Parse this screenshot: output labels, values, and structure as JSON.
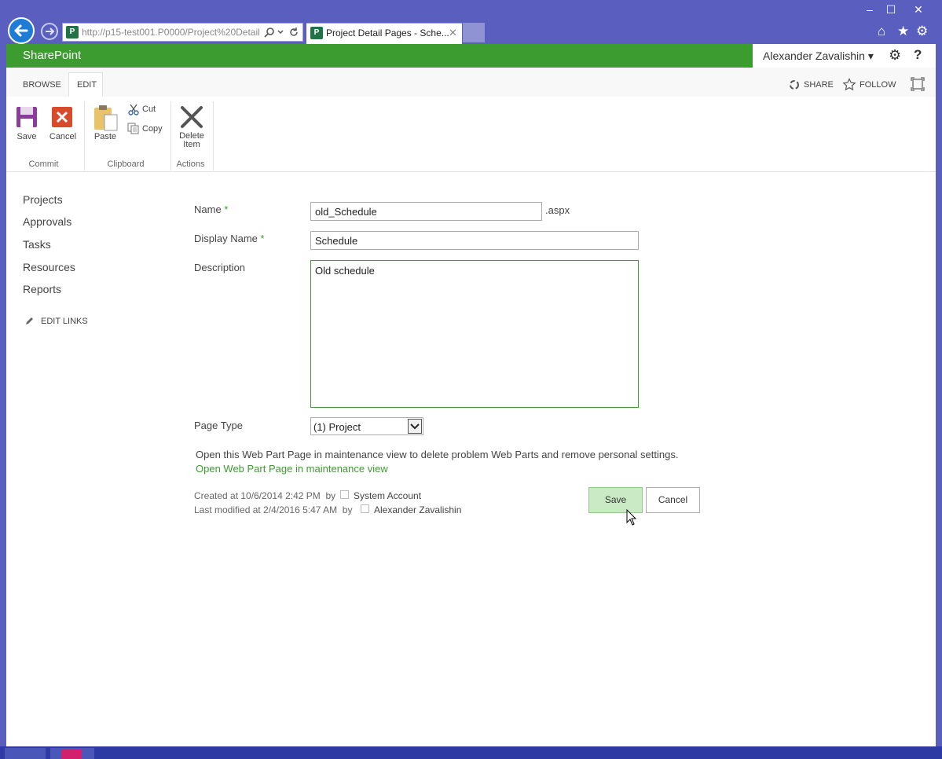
{
  "browser": {
    "url": "http://p15-test001.P0000/Project%20Detail",
    "tab_title": "Project Detail Pages - Sche...",
    "tab_close": "✕",
    "minimize": "–",
    "maximize": "☐",
    "close": "✕",
    "home_icon": "⌂",
    "favorites_icon": "★",
    "tools_icon": "⚙"
  },
  "suite": {
    "brand": "SharePoint",
    "user": "Alexander Zavalishin ▾",
    "settings_icon": "⚙",
    "help_icon": "?"
  },
  "ribbon": {
    "tabs": [
      "BROWSE",
      "EDIT"
    ],
    "share": "SHARE",
    "follow": "FOLLOW",
    "buttons": {
      "save": "Save",
      "cancel": "Cancel",
      "paste": "Paste",
      "cut": "Cut",
      "copy": "Copy",
      "delete_line1": "Delete",
      "delete_line2": "Item"
    },
    "groups": {
      "commit": "Commit",
      "clipboard": "Clipboard",
      "actions": "Actions"
    }
  },
  "nav": {
    "items": [
      "Projects",
      "Approvals",
      "Tasks",
      "Resources",
      "Reports"
    ],
    "edit_links": "EDIT LINKS"
  },
  "form": {
    "name_label": "Name",
    "required_mark": "*",
    "name_value": "old_Schedule",
    "name_suffix": ".aspx",
    "display_label": "Display Name",
    "display_value": "Schedule",
    "desc_label": "Description",
    "desc_value": "Old schedule",
    "pagetype_label": "Page Type",
    "pagetype_value": "(1) Project",
    "maint_text": "Open this Web Part Page in maintenance view to delete problem Web Parts and remove personal settings.",
    "maint_link": "Open Web Part Page in maintenance view",
    "created": "Created at 10/6/2014 2:42 PM  by",
    "created_by": "System Account",
    "modified": "Last modified at 2/4/2016 5:47 AM  by",
    "modified_by": "Alexander Zavalishin",
    "save": "Save",
    "cancel": "Cancel"
  },
  "colors": {
    "accent": "#3c9c2f",
    "chrome": "#5a5fbf"
  }
}
